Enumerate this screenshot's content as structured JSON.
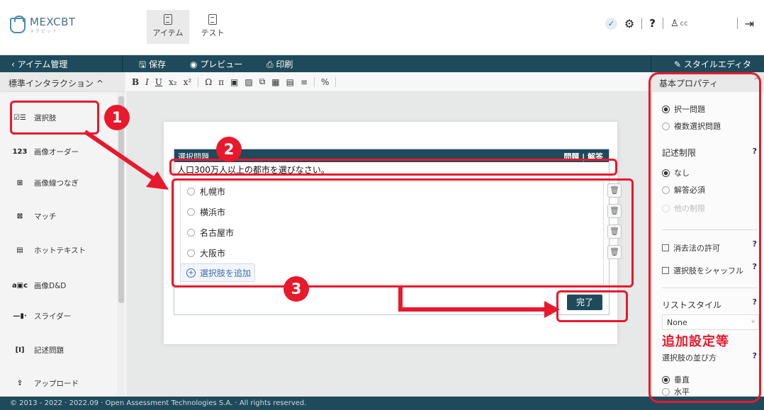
{
  "app": {
    "logo": "MEXCBT",
    "logo_sub": "メクビット"
  },
  "nav": {
    "items_label": "アイテム",
    "test_label": "テスト"
  },
  "header_right": {
    "help": "?",
    "user": "cc",
    "check": "✓"
  },
  "toolbar": {
    "back": "‹ アイテム管理",
    "save": "保存",
    "preview": "プレビュー",
    "print": "印刷",
    "style_editor": "スタイルエディタ"
  },
  "left_panel": {
    "title": "標準インタラクション",
    "items": [
      {
        "label": "選択肢",
        "icon": "choice-icon"
      },
      {
        "label": "画像オーダー",
        "icon": "order-icon"
      },
      {
        "label": "画像線つなぎ",
        "icon": "match-lines-icon"
      },
      {
        "label": "マッチ",
        "icon": "match-icon"
      },
      {
        "label": "ホットテキスト",
        "icon": "hottext-icon"
      },
      {
        "label": "画像D&D",
        "icon": "drag-drop-icon"
      },
      {
        "label": "スライダー",
        "icon": "slider-icon"
      },
      {
        "label": "記述問題",
        "icon": "text-entry-icon"
      },
      {
        "label": "アップロード",
        "icon": "upload-icon"
      }
    ]
  },
  "rte": {
    "buttons": [
      "B",
      "I",
      "U",
      "x₂",
      "x²",
      "Ω",
      "π",
      "▣",
      "▨",
      "⧉",
      "▦",
      "▤",
      "≡",
      "%"
    ]
  },
  "question": {
    "header": "選択問題",
    "header_right": "問題 | 解答",
    "prompt": "人口300万人以上の都市を選びなさい。",
    "choices": [
      "札幌市",
      "横浜市",
      "名古屋市",
      "大阪市"
    ],
    "add_choice": "選択肢を追加",
    "done": "完了"
  },
  "right_panel": {
    "title": "基本プロパティ",
    "choice_type": [
      "択一問題",
      "複数選択問題"
    ],
    "limit_title": "記述制限",
    "limit_options": [
      "なし",
      "解答必須",
      "他の制限"
    ],
    "eliminate": "消去法の許可",
    "shuffle": "選択肢をシャッフル",
    "list_style_title": "リストスタイル",
    "list_style_value": "None",
    "extra_label": "追加設定等",
    "orientation_title": "選択肢の並び方",
    "orientation_options": [
      "垂直",
      "水平"
    ]
  },
  "annotations": {
    "n1": "1",
    "n2": "2",
    "n3": "3"
  },
  "footer": "© 2013 - 2022 · 2022.09 · Open Assessment Technologies S.A. · All rights reserved.",
  "colors": {
    "header": "#1f4a5c",
    "accent": "#e8192c"
  }
}
